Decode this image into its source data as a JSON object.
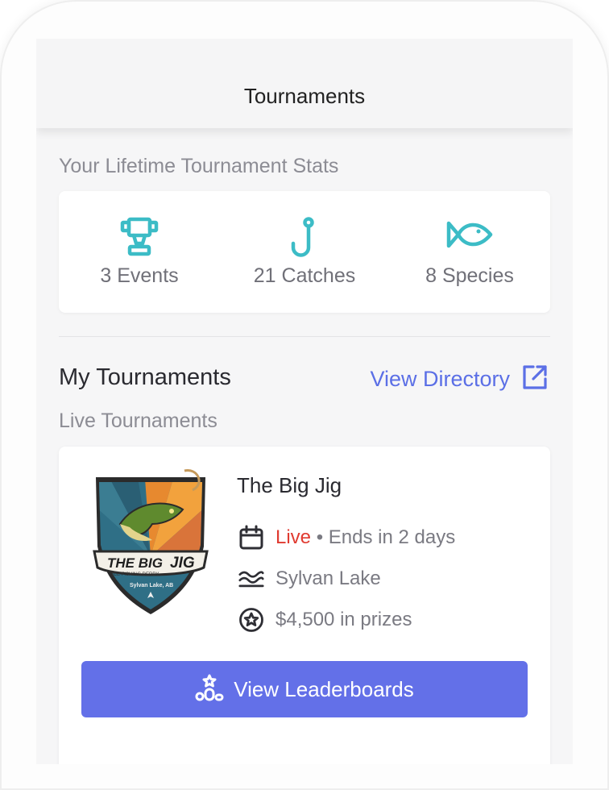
{
  "header": {
    "title": "Tournaments"
  },
  "stats": {
    "section_label": "Your Lifetime Tournament Stats",
    "items": [
      {
        "icon": "trophy-icon",
        "label": "3 Events"
      },
      {
        "icon": "fishing-hook-icon",
        "label": "21 Catches"
      },
      {
        "icon": "fish-icon",
        "label": "8 Species"
      }
    ]
  },
  "my_tournaments": {
    "title": "My Tournaments",
    "view_directory": "View Directory",
    "live_label": "Live Tournaments"
  },
  "event": {
    "name": "The Big Jig",
    "status": "Live",
    "separator": "•",
    "ends": "Ends in 2 days",
    "location": "Sylvan Lake",
    "prizes": "$4,500 in prizes",
    "button_label": "View Leaderboards",
    "logo": {
      "line1": "THE BIG",
      "line2": "JIG",
      "subtitle": "ICE FISHING DERBY",
      "place": "Sylvan Lake, AB"
    }
  },
  "colors": {
    "accent": "#5b6fe6",
    "button": "#6370e8",
    "teal": "#3cbcc6",
    "live": "#e03a30"
  }
}
